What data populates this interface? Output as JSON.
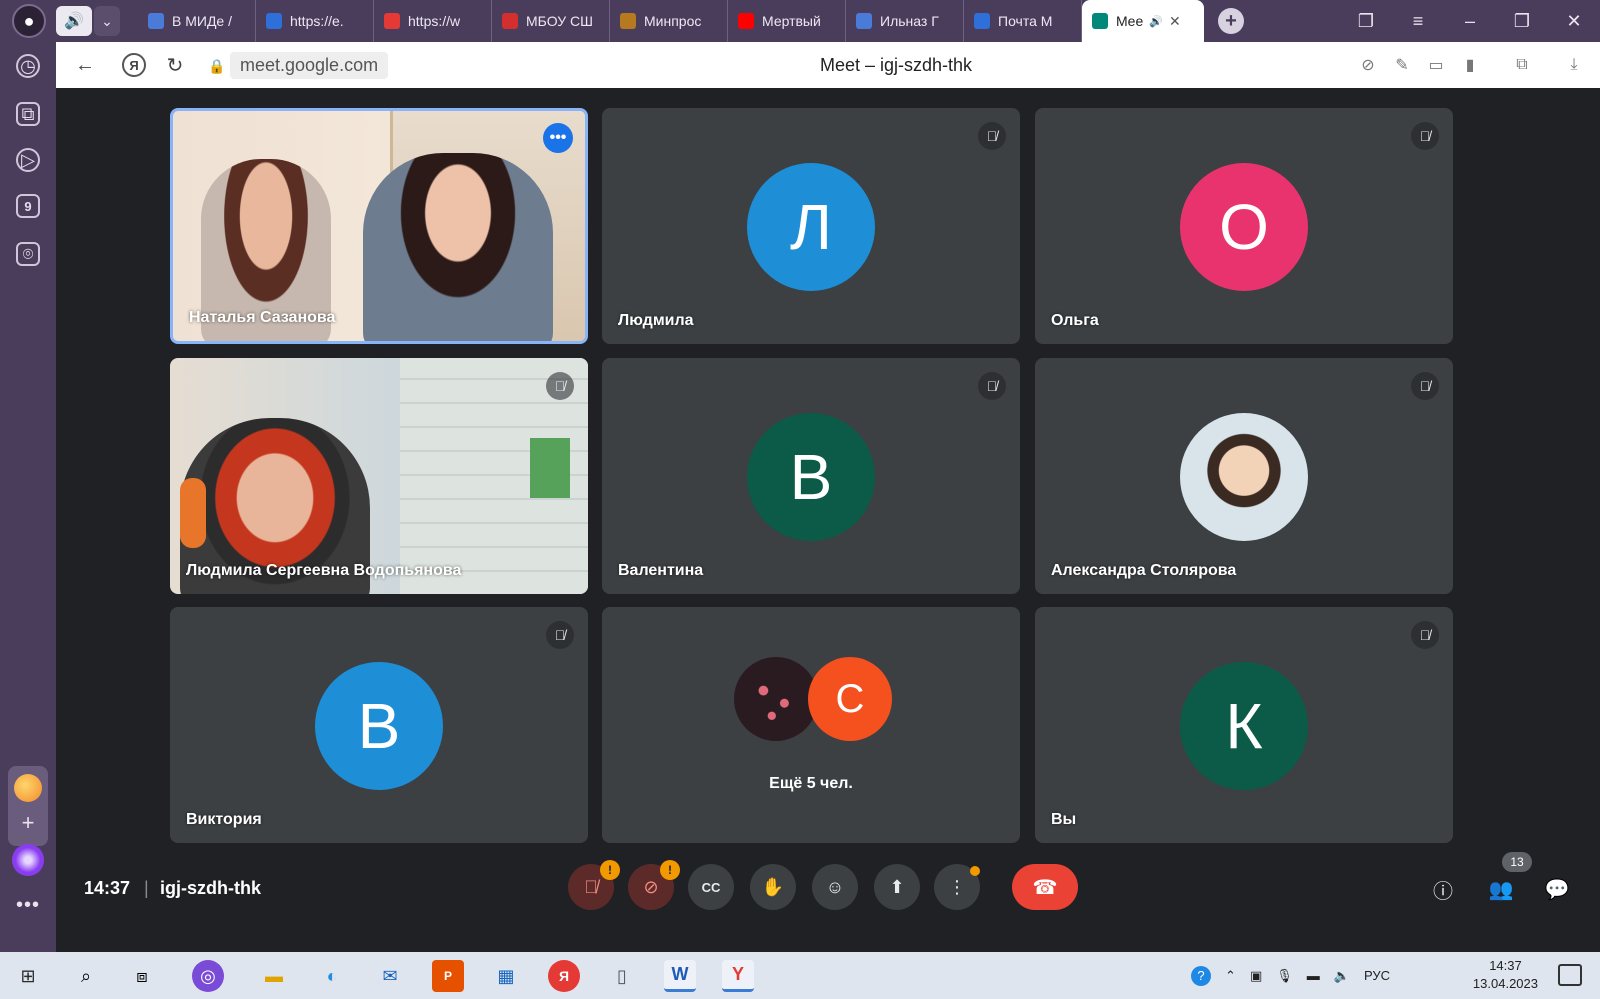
{
  "browser": {
    "tabs": [
      {
        "label": "В МИДе /",
        "icon_color": "#4a7bd8"
      },
      {
        "label": "https://e.",
        "icon_color": "#2e6fd9"
      },
      {
        "label": "https://w",
        "icon_color": "#e53935"
      },
      {
        "label": "МБОУ СШ",
        "icon_color": "#d32f2f"
      },
      {
        "label": "Минпрос",
        "icon_color": "#b7791f"
      },
      {
        "label": "Мертвый",
        "icon_color": "#ff0000"
      },
      {
        "label": "Ильназ Г",
        "icon_color": "#4a7bd8"
      },
      {
        "label": "Почта М",
        "icon_color": "#2e6fd9"
      },
      {
        "label": "Mee",
        "icon_color": "#00897b"
      }
    ],
    "url": "meet.google.com",
    "page_title": "Meet – igj-szdh-thk"
  },
  "meet": {
    "participants": [
      {
        "name": "Наталья Сазанова",
        "type": "video"
      },
      {
        "name": "Людмила",
        "initial": "Л",
        "color": "#1e8fd6"
      },
      {
        "name": "Ольга",
        "initial": "О",
        "color": "#e8336e"
      },
      {
        "name": "Людмила Сергеевна Водопьянова",
        "type": "video"
      },
      {
        "name": "Валентина",
        "initial": "В",
        "color": "#0b5b48"
      },
      {
        "name": "Александра Столярова",
        "type": "photo"
      },
      {
        "name": "Виктория",
        "initial": "В",
        "color": "#1e8fd6"
      },
      {
        "name": "Вы",
        "initial": "К",
        "color": "#0b5b48"
      }
    ],
    "more_tile": {
      "initial": "С",
      "color": "#f4511e",
      "label": "Ещё 5 чел."
    },
    "bottom": {
      "time": "14:37",
      "separator": "|",
      "meeting_code": "igj-szdh-thk",
      "participant_count": "13"
    }
  },
  "taskbar": {
    "lang": "РУС",
    "time": "14:37",
    "date": "13.04.2023"
  }
}
